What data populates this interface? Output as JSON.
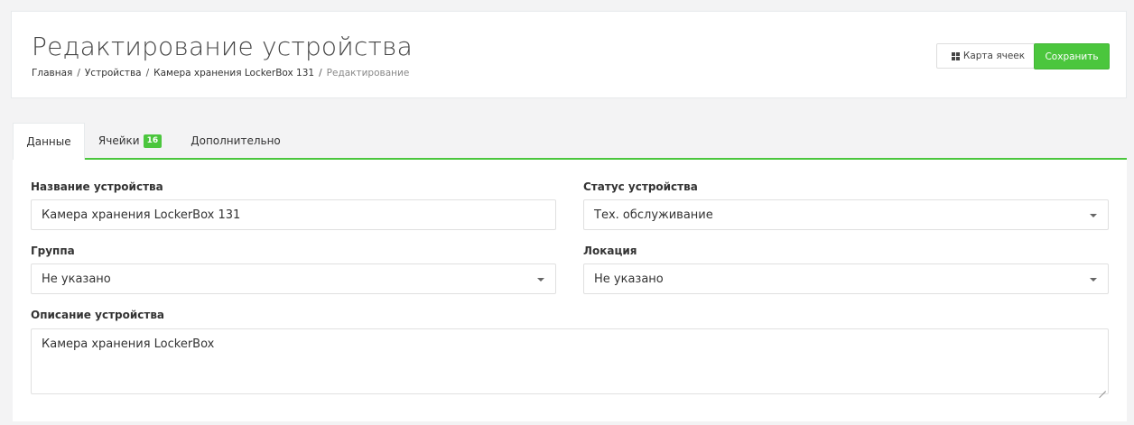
{
  "header": {
    "title": "Редактирование устройства",
    "breadcrumb": [
      "Главная",
      "Устройства",
      "Камера хранения LockerBox 131",
      "Редактирование"
    ],
    "separator": "/",
    "map_button_label": "Карта ячеек",
    "map_button_icon": "grid-icon",
    "save_button_label": "Сохранить",
    "accent_color": "#4bc63d"
  },
  "tabs": [
    {
      "label": "Данные",
      "active": true
    },
    {
      "label": "Ячейки",
      "badge": "16",
      "active": false
    },
    {
      "label": "Дополнительно",
      "active": false
    }
  ],
  "form": {
    "device_name": {
      "label": "Название устройства",
      "value": "Камера хранения LockerBox 131"
    },
    "device_status": {
      "label": "Статус устройства",
      "value": "Тех. обслуживание"
    },
    "group": {
      "label": "Группа",
      "value": "Не указано"
    },
    "location": {
      "label": "Локация",
      "value": "Не указано"
    },
    "description": {
      "label": "Описание устройства",
      "value": "Камера хранения LockerBox"
    }
  }
}
